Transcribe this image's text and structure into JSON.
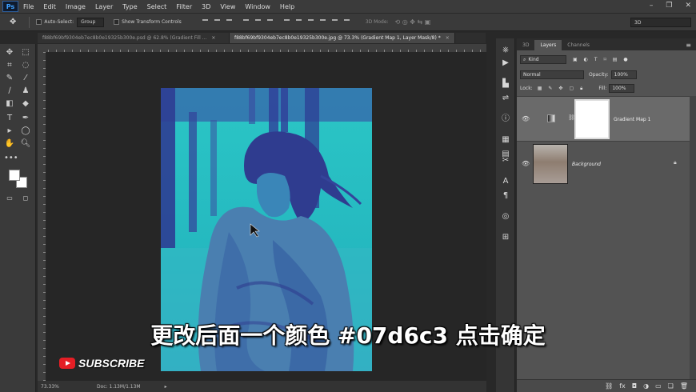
{
  "app": {
    "logo": "Ps"
  },
  "menu": [
    "File",
    "Edit",
    "Image",
    "Layer",
    "Type",
    "Select",
    "Filter",
    "3D",
    "View",
    "Window",
    "Help"
  ],
  "window_controls": {
    "minimize": "–",
    "restore": "❐",
    "close": "✕"
  },
  "options": {
    "move_icon": "✥",
    "auto_select_label": "Auto-Select:",
    "auto_select_value": "Group",
    "show_transform_label": "Show Transform Controls",
    "mode_label": "3D Mode:",
    "workspace": "3D"
  },
  "tabs": [
    {
      "label": "f88bf69bf9304eb7ec8b0e19325b300e.psd @ 62.8% (Gradient Fill ...",
      "close": "×"
    },
    {
      "label": "f88bf69bf9304eb7ec8b0e19325b300e.jpg @ 73.3% (Gradient Map 1, Layer Mask/8) *",
      "close": "×"
    }
  ],
  "status": {
    "zoom": "73.33%",
    "doc": "Doc: 1.13M/1.13M",
    "arrow": "▸"
  },
  "layers_panel": {
    "tabs": [
      "3D",
      "Layers",
      "Channels"
    ],
    "panel_menu": "≡",
    "filter_value": "Kind",
    "blend_mode": "Normal",
    "opacity_label": "Opacity:",
    "opacity_value": "100%",
    "lock_label": "Lock:",
    "fill_label": "Fill:",
    "fill_value": "100%",
    "layers": [
      {
        "name": "Gradient Map 1",
        "visible": true,
        "selected": true
      },
      {
        "name": "Background",
        "visible": true,
        "selected": false,
        "locked": true
      }
    ],
    "bottom_icons": [
      "⛓",
      "fx",
      "◘",
      "◑",
      "▭",
      "❏",
      "🗑"
    ]
  },
  "subtitle": "更改后面一个颜色 #07d6c3 点击确定",
  "subscribe": "SUBSCRIBE",
  "colors": {
    "accent": "#07d6c3",
    "foreground": "#ffffff",
    "background": "#ffffff"
  }
}
